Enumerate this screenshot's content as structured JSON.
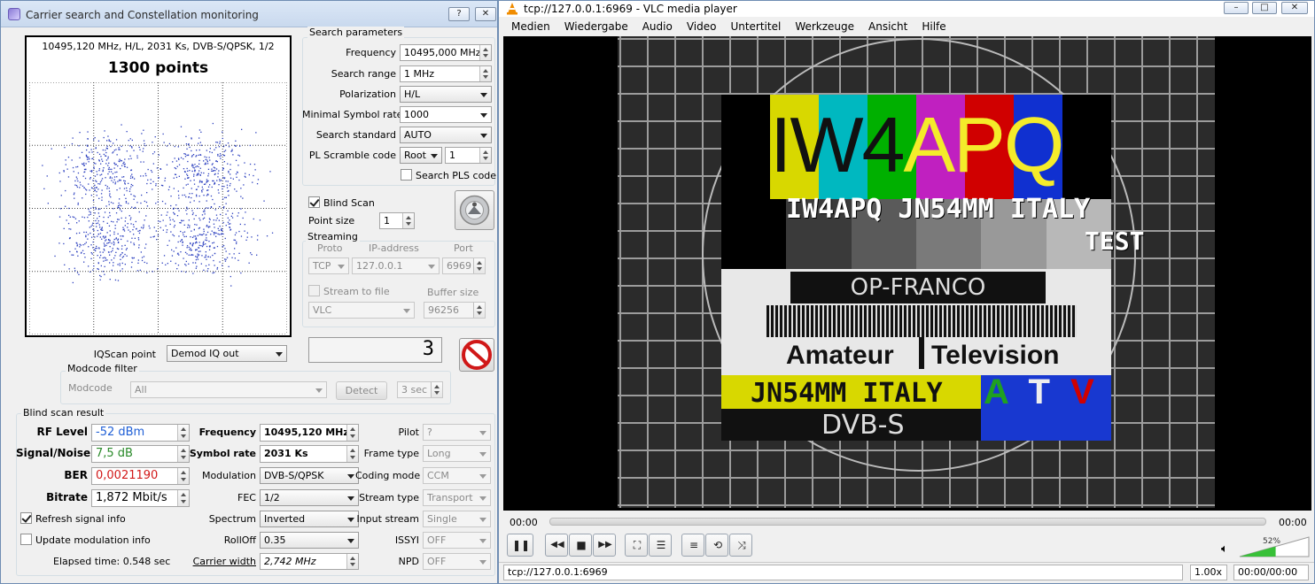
{
  "left": {
    "title": "Carrier search and Constellation monitoring",
    "help_label": "?",
    "close_label": "✕",
    "const_header": "10495,120 MHz, H/L, 2031 Ks, DVB-S/QPSK, 1/2",
    "points_label": "1300 points",
    "search_params": {
      "group_title": "Search parameters",
      "frequency_label": "Frequency",
      "frequency_value": "10495,000 MHz",
      "range_label": "Search range",
      "range_value": "1 MHz",
      "pol_label": "Polarization",
      "pol_value": "H/L",
      "minsr_label": "Minimal Symbol rate",
      "minsr_value": "1000",
      "std_label": "Search standard",
      "std_value": "AUTO",
      "pls_label": "PL Scramble code",
      "pls_type": "Root",
      "pls_value": "1",
      "search_pls_label": "Search PLS code"
    },
    "blind_scan_label": "Blind Scan",
    "point_size_label": "Point size",
    "point_size_value": "1",
    "streaming": {
      "group_title": "Streaming",
      "proto_label": "Proto",
      "ip_label": "IP-address",
      "port_label": "Port",
      "proto_value": "TCP",
      "ip_value": "127.0.0.1",
      "port_value": "6969",
      "stream_file_label": "Stream to file",
      "buffer_label": "Buffer size",
      "player_value": "VLC",
      "buffer_value": "96256"
    },
    "counter_value": "3",
    "iq_label": "IQScan point",
    "iq_value": "Demod IQ out",
    "modcode": {
      "group_title": "Modcode filter",
      "label": "Modcode",
      "value": "All",
      "detect_label": "Detect",
      "sec_value": "3 sec"
    },
    "result": {
      "group_title": "Blind scan result",
      "rf_label": "RF Level",
      "rf_value": "-52 dBm",
      "sn_label": "Signal/Noise",
      "sn_value": "7,5 dB",
      "ber_label": "BER",
      "ber_value": "0,0021190",
      "bitrate_label": "Bitrate",
      "bitrate_value": "1,872 Mbit/s",
      "freq_label": "Frequency",
      "freq_value": "10495,120 MHz",
      "sr_label": "Symbol rate",
      "sr_value": "2031 Ks",
      "mod_label": "Modulation",
      "mod_value": "DVB-S/QPSK",
      "fec_label": "FEC",
      "fec_value": "1/2",
      "spectrum_label": "Spectrum",
      "spectrum_value": "Inverted",
      "rolloff_label": "RollOff",
      "rolloff_value": "0.35",
      "cw_label": "Carrier width",
      "cw_value": "2,742 MHz",
      "pilot_label": "Pilot",
      "pilot_value": "?",
      "frame_label": "Frame type",
      "frame_value": "Long",
      "coding_label": "Coding mode",
      "coding_value": "CCM",
      "stype_label": "Stream type",
      "stype_value": "Transport",
      "istream_label": "Input stream",
      "istream_value": "Single",
      "issyi_label": "ISSYI",
      "issyi_value": "OFF",
      "npd_label": "NPD",
      "npd_value": "OFF",
      "refresh_label": "Refresh signal info",
      "update_label": "Update modulation info",
      "elapsed": "Elapsed time: 0.548 sec"
    }
  },
  "vlc": {
    "title": "tcp://127.0.0.1:6969 - VLC media player",
    "menu": [
      "Medien",
      "Wiedergabe",
      "Audio",
      "Video",
      "Untertitel",
      "Werkzeuge",
      "Ansicht",
      "Hilfe"
    ],
    "video": {
      "callsign_a": "IW4",
      "callsign_b": "APQ",
      "line2": "IW4APQ JN54MM ITALY",
      "test": "TEST",
      "op": "OP-FRANCO",
      "amateur": "Amateur",
      "television": "Television",
      "locator": "JN54MM ITALY",
      "atv_a": "A",
      "atv_t": "T",
      "atv_v": "V",
      "dvbs": "DVB-S"
    },
    "time_start": "00:00",
    "time_end": "00:00",
    "volume": "52%",
    "status_url": "tcp://127.0.0.1:6969",
    "speed": "1.00x",
    "time_status": "00:00/00:00"
  },
  "colors": {
    "rf": "#1f5fd6",
    "sn": "#2a8a2a",
    "ber": "#d21919",
    "points": "#2b3fbf"
  }
}
